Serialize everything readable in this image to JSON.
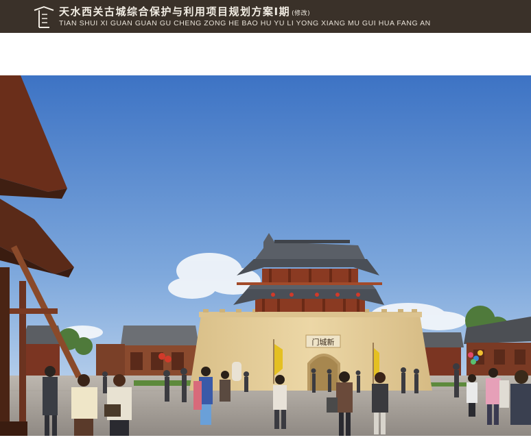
{
  "header": {
    "title_cn": "天水西关古城综合保护与利用项目规划方案Ⅰ期",
    "revision_note": "(修改)",
    "title_en": "TIAN SHUI XI GUAN GUAN GU CHENG ZONG HE BAO HU YU LI YONG XIANG MU GUI HUA FANG AN"
  },
  "scene": {
    "gate_plaque": "门城新",
    "colors": {
      "header_bg": "#3a3129",
      "sky_top": "#3d73c4",
      "sky_bottom": "#cfe0f2",
      "wall": "#e6cf9b",
      "roof": "#4a4f57",
      "timber": "#8a3a22",
      "plaza": "#a9a39c"
    }
  }
}
